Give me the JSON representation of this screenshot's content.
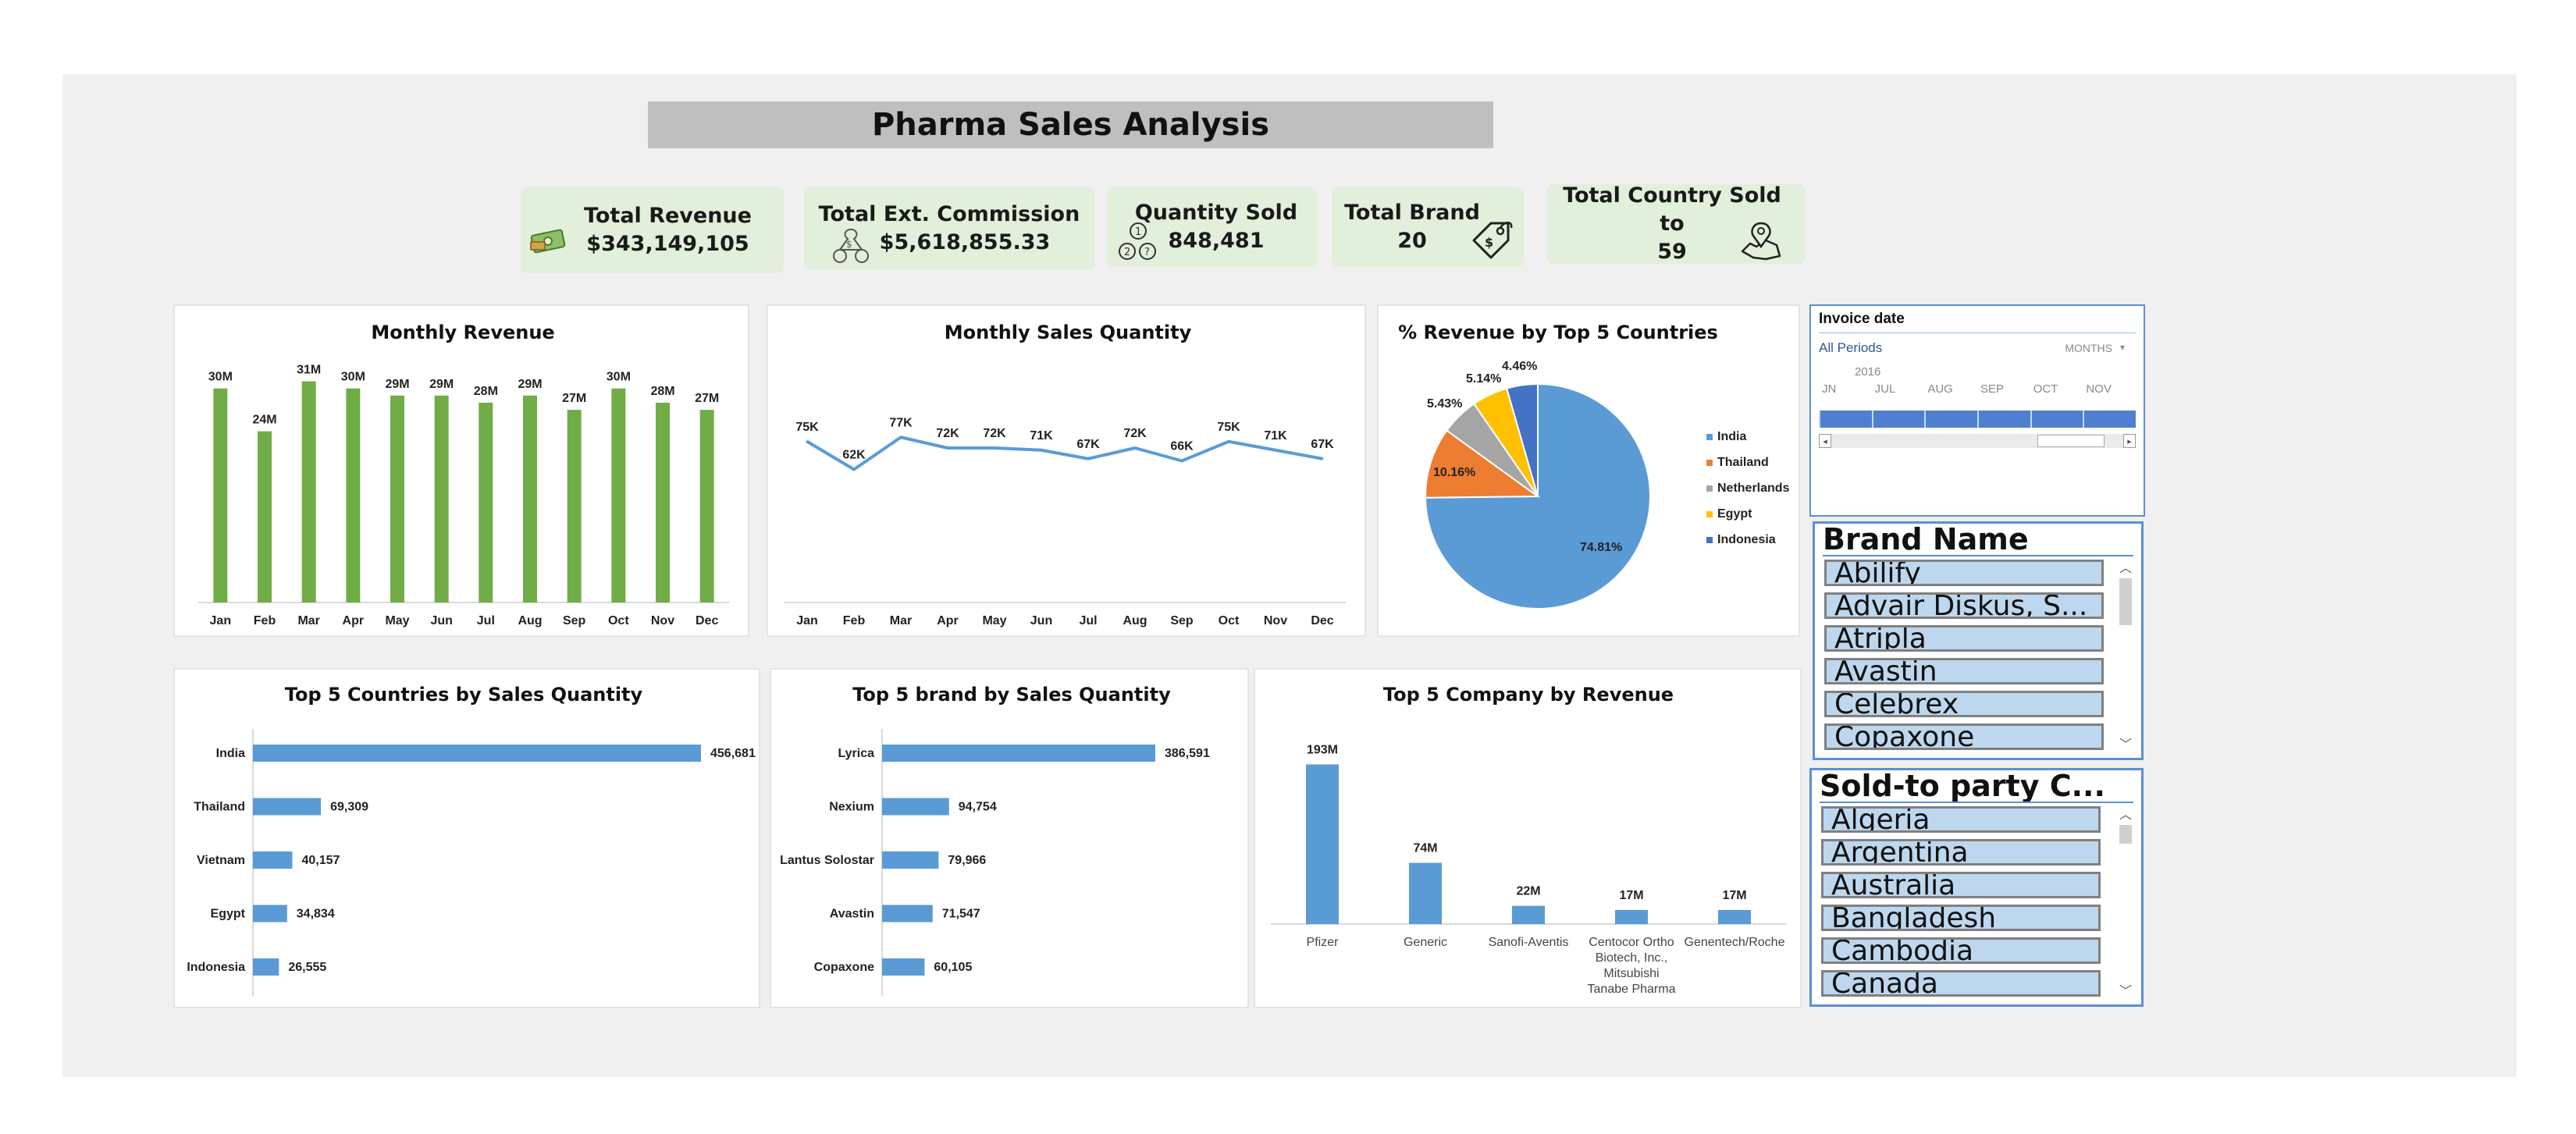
{
  "title": "Pharma Sales Analysis",
  "kpis": [
    {
      "label": "Total Revenue",
      "value": "$343,149,105",
      "icon": "cash-icon"
    },
    {
      "label": "Total Ext. Commission",
      "value": "$5,618,855.33",
      "icon": "commission-icon"
    },
    {
      "label": "Quantity Sold",
      "value": "848,481",
      "icon": "coins-icon"
    },
    {
      "label": "Total Brand",
      "value": "20",
      "icon": "tag-icon"
    },
    {
      "label": "Total Country Sold to",
      "value": "59",
      "icon": "map-pin-icon"
    }
  ],
  "colors": {
    "green": "#70ad47",
    "blue": "#5b9bd5",
    "orange": "#ed7d31",
    "gray": "#a5a5a5",
    "yellow": "#ffc000",
    "dark_blue": "#4472c4",
    "kpi_bg": "#e2efda"
  },
  "monthly_revenue": {
    "title": "Monthly Revenue",
    "chart_data": {
      "type": "bar",
      "categories": [
        "Jan",
        "Feb",
        "Mar",
        "Apr",
        "May",
        "Jun",
        "Jul",
        "Aug",
        "Sep",
        "Oct",
        "Nov",
        "Dec"
      ],
      "values": [
        30,
        24,
        31,
        30,
        29,
        29,
        28,
        29,
        27,
        30,
        28,
        27
      ],
      "labels": [
        "30M",
        "24M",
        "31M",
        "30M",
        "29M",
        "29M",
        "28M",
        "29M",
        "27M",
        "30M",
        "28M",
        "27M"
      ],
      "unit": "M"
    }
  },
  "monthly_quantity": {
    "title": "Monthly Sales Quantity",
    "chart_data": {
      "type": "line",
      "categories": [
        "Jan",
        "Feb",
        "Mar",
        "Apr",
        "May",
        "Jun",
        "Jul",
        "Aug",
        "Sep",
        "Oct",
        "Nov",
        "Dec"
      ],
      "values": [
        75,
        62,
        77,
        72,
        72,
        71,
        67,
        72,
        66,
        75,
        71,
        67
      ],
      "labels": [
        "75K",
        "62K",
        "77K",
        "72K",
        "72K",
        "71K",
        "67K",
        "72K",
        "66K",
        "75K",
        "71K",
        "67K"
      ],
      "unit": "K"
    }
  },
  "revenue_by_country": {
    "title": "% Revenue by Top 5 Countries",
    "chart_data": {
      "type": "pie",
      "categories": [
        "India",
        "Thailand",
        "Netherlands",
        "Egypt",
        "Indonesia"
      ],
      "values": [
        74.81,
        10.16,
        5.43,
        5.14,
        4.46
      ],
      "labels": [
        "74.81%",
        "10.16%",
        "5.43%",
        "5.14%",
        "4.46%"
      ],
      "legend": "right"
    }
  },
  "top_countries": {
    "title": "Top 5 Countries by Sales Quantity",
    "chart_data": {
      "type": "bar",
      "orientation": "horizontal",
      "categories": [
        "India",
        "Thailand",
        "Vietnam",
        "Egypt",
        "Indonesia"
      ],
      "values": [
        456681,
        69309,
        40157,
        34834,
        26555
      ],
      "labels": [
        "456,681",
        "69,309",
        "40,157",
        "34,834",
        "26,555"
      ]
    }
  },
  "top_brands": {
    "title": "Top 5 brand by Sales Quantity",
    "chart_data": {
      "type": "bar",
      "orientation": "horizontal",
      "categories": [
        "Lyrica",
        "Nexium",
        "Lantus Solostar",
        "Avastin",
        "Copaxone"
      ],
      "values": [
        386591,
        94754,
        79966,
        71547,
        60105
      ],
      "labels": [
        "386,591",
        "94,754",
        "79,966",
        "71,547",
        "60,105"
      ]
    }
  },
  "top_companies": {
    "title": "Top 5 Company by Revenue",
    "chart_data": {
      "type": "bar",
      "categories": [
        "Pfizer",
        "Generic",
        "Sanofi-Aventis",
        "Centocor Ortho Biotech, Inc., Mitsubishi Tanabe Pharma",
        "Genentech/Roche"
      ],
      "category_lines": [
        [
          "Pfizer"
        ],
        [
          "Generic"
        ],
        [
          "Sanofi-Aventis"
        ],
        [
          "Centocor Ortho",
          "Biotech, Inc.,",
          "Mitsubishi",
          "Tanabe Pharma"
        ],
        [
          "Genentech/Roche"
        ]
      ],
      "values": [
        193,
        74,
        22,
        17,
        17
      ],
      "labels": [
        "193M",
        "74M",
        "22M",
        "17M",
        "17M"
      ],
      "unit": "M"
    }
  },
  "timeline": {
    "title": "Invoice date",
    "period": "All Periods",
    "level": "MONTHS",
    "year": "2016",
    "months": [
      "JN",
      "JUL",
      "AUG",
      "SEP",
      "OCT",
      "NOV"
    ]
  },
  "brand_slicer": {
    "title": "Brand Name",
    "items": [
      "Abilify",
      "Advair Diskus, S...",
      "Atripla",
      "Avastin",
      "Celebrex",
      "Copaxone"
    ]
  },
  "country_slicer": {
    "title": "Sold-to party C...",
    "items": [
      "Algeria",
      "Argentina",
      "Australia",
      "Bangladesh",
      "Cambodia",
      "Canada"
    ]
  }
}
